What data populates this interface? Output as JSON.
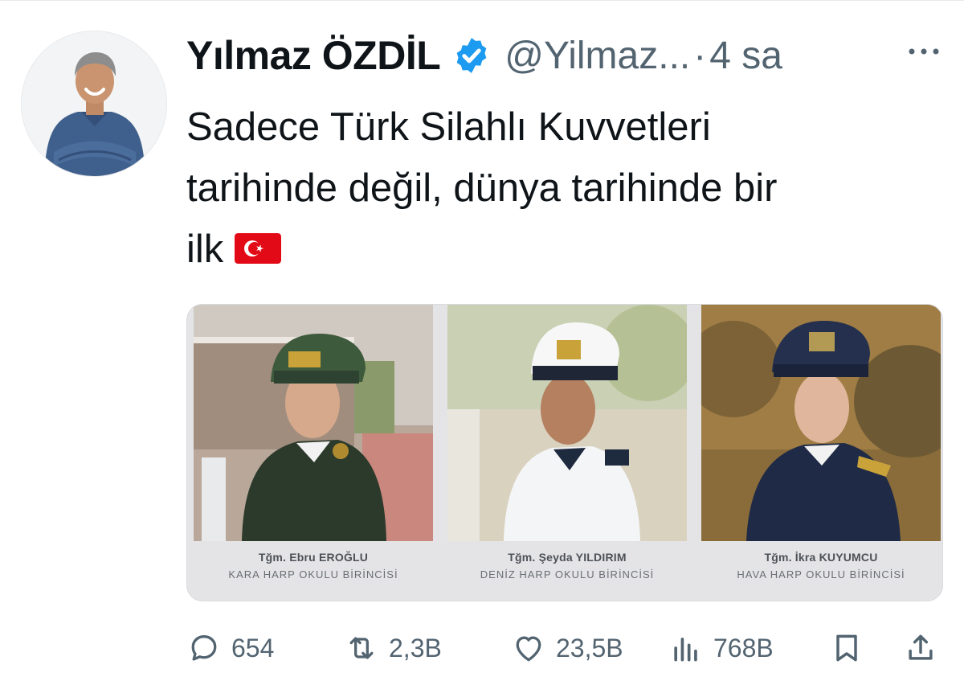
{
  "tweet": {
    "author_name": "Yılmaz ÖZDİL",
    "handle": "@Yilmaz...",
    "separator": "·",
    "time": "4 sa",
    "text_lines": [
      "Sadece Türk Silahlı Kuvvetleri",
      "tarihinde değil, dünya tarihinde bir",
      "ilk"
    ]
  },
  "media": {
    "panels": [
      {
        "name": "Tğm. Ebru EROĞLU",
        "subtitle": "KARA HARP OKULU BİRİNCİSİ"
      },
      {
        "name": "Tğm. Şeyda YILDIRIM",
        "subtitle": "DENİZ HARP OKULU BİRİNCİSİ"
      },
      {
        "name": "Tğm. İkra KUYUMCU",
        "subtitle": "HAVA HARP OKULU BİRİNCİSİ"
      }
    ]
  },
  "actions": {
    "replies": "654",
    "retweets": "2,3B",
    "likes": "23,5B",
    "views": "768B"
  },
  "colors": {
    "text": "#0f1419",
    "muted": "#536471",
    "verified": "#1d9bf0",
    "flag_red": "#e30a17"
  },
  "icons": [
    "verified-badge-icon",
    "more-icon",
    "reply-icon",
    "retweet-icon",
    "like-icon",
    "views-icon",
    "bookmark-icon",
    "share-icon"
  ]
}
